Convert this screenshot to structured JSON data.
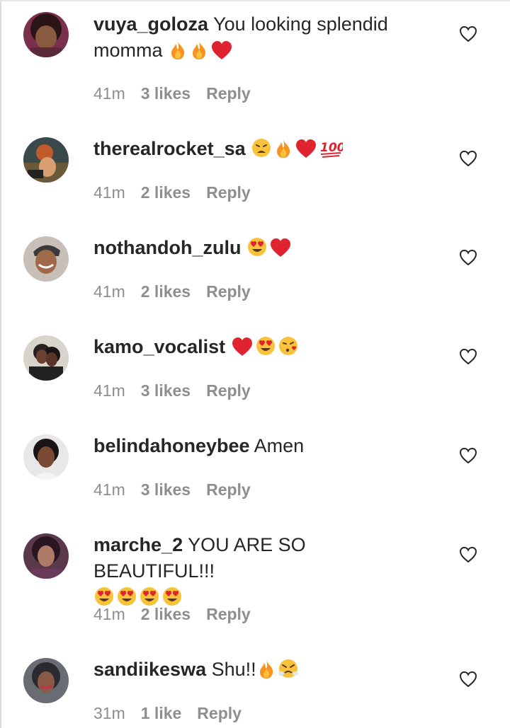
{
  "comments": [
    {
      "username": "vuya_goloza",
      "text": "You looking splendid momma",
      "emojis": [
        "fire",
        "fire",
        "red-heart"
      ],
      "time": "41m",
      "likes": "3 likes",
      "reply": "Reply"
    },
    {
      "username": "therealrocket_sa",
      "text": "",
      "emojis": [
        "weary-face",
        "fire",
        "red-heart",
        "hundred-points"
      ],
      "time": "41m",
      "likes": "2 likes",
      "reply": "Reply"
    },
    {
      "username": "nothandoh_zulu",
      "text": "",
      "emojis": [
        "heart-eyes",
        "red-heart"
      ],
      "time": "41m",
      "likes": "2 likes",
      "reply": "Reply"
    },
    {
      "username": "kamo_vocalist",
      "text": "",
      "emojis": [
        "red-heart",
        "heart-eyes",
        "kissing-heart"
      ],
      "time": "41m",
      "likes": "3 likes",
      "reply": "Reply"
    },
    {
      "username": "belindahoneybee",
      "text": "Amen",
      "emojis": [],
      "time": "41m",
      "likes": "3 likes",
      "reply": "Reply"
    },
    {
      "username": "marche_2",
      "text": "YOU ARE SO BEAUTIFUL!!!",
      "emojis": [
        "heart-eyes",
        "heart-eyes",
        "heart-eyes",
        "heart-eyes"
      ],
      "time": "41m",
      "likes": "2 likes",
      "reply": "Reply"
    },
    {
      "username": "sandiikeswa",
      "text": "Shu!!",
      "emojis": [
        "fire",
        "triumph-face"
      ],
      "time": "31m",
      "likes": "1 like",
      "reply": "Reply"
    }
  ],
  "colors": {
    "text": "#262626",
    "meta": "#8e8e8e",
    "emoji_red": "#e0242f",
    "emoji_yellow": "#f9c23c",
    "emoji_orange": "#f7931e"
  },
  "icons": {
    "like": "heart-outline-icon"
  }
}
